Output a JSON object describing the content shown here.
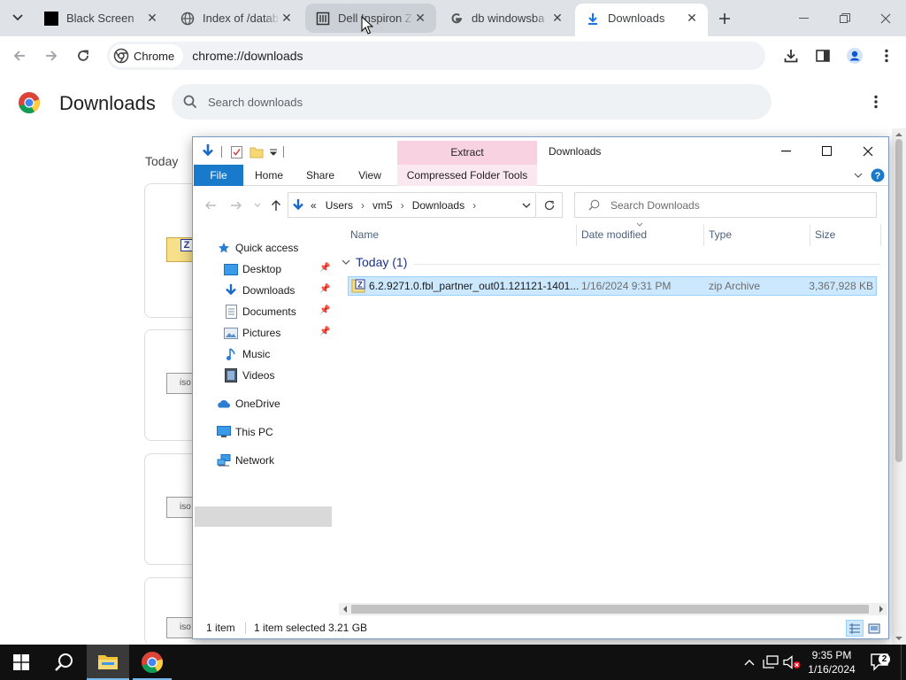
{
  "browser": {
    "tabs": [
      {
        "title": "Black Screen",
        "icon": "black-square-icon",
        "state": "normal"
      },
      {
        "title": "Index of /datab",
        "icon": "globe-icon",
        "state": "normal"
      },
      {
        "title": "Dell Inspiron Z",
        "icon": "page-icon",
        "state": "hover"
      },
      {
        "title": "db windowsba",
        "icon": "google-g-icon",
        "state": "normal"
      },
      {
        "title": "Downloads",
        "icon": "download-arrow-icon",
        "state": "active"
      }
    ],
    "chip_label": "Chrome",
    "url": "chrome://downloads"
  },
  "downloads_page": {
    "title": "Downloads",
    "search_placeholder": "Search downloads",
    "date_group": "Today",
    "card_icons": [
      "Z",
      "iso",
      "iso",
      "iso"
    ]
  },
  "explorer": {
    "window_title": "Downloads",
    "contextual_header": "Extract",
    "ribbon_tabs": [
      "File",
      "Home",
      "Share",
      "View",
      "Compressed Folder Tools"
    ],
    "breadcrumb": [
      "Users",
      "vm5",
      "Downloads"
    ],
    "breadcrumb_overflow": "«",
    "search_placeholder": "Search Downloads",
    "nav": {
      "quick_access": "Quick access",
      "pinned": [
        "Desktop",
        "Downloads",
        "Documents",
        "Pictures"
      ],
      "unpinned": [
        "Music",
        "Videos"
      ],
      "onedrive": "OneDrive",
      "this_pc": "This PC",
      "network": "Network"
    },
    "columns": [
      "Name",
      "Date modified",
      "Type",
      "Size"
    ],
    "group_label": "Today (1)",
    "files": [
      {
        "name": "6.2.9271.0.fbl_partner_out01.121121-1401...",
        "date": "1/16/2024 9:31 PM",
        "type": "zip Archive",
        "size": "3,367,928 KB"
      }
    ],
    "status": {
      "count": "1 item",
      "selected": "1 item selected",
      "size": "3.21 GB"
    }
  },
  "taskbar": {
    "time": "9:35 PM",
    "date": "1/16/2024",
    "notification_count": "2"
  },
  "colors": {
    "file_tab": "#1979ca",
    "extract_header": "#f8d2e0",
    "selection": "#cce8ff",
    "taskbar": "#101010"
  }
}
